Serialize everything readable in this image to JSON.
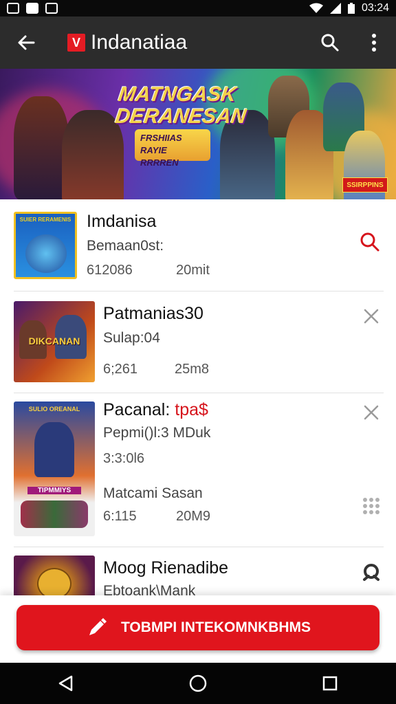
{
  "status_bar": {
    "time": "03:24"
  },
  "app_bar": {
    "title": "Indanatiaa",
    "logo_letter": "V"
  },
  "banner": {
    "title_line1": "MATNGASK",
    "title_line2": "DERANESAN",
    "sub_line1": "FRSHIIAS",
    "sub_line2": "RAYIE RRRREN",
    "badge": "SSIRPPINS"
  },
  "rows": [
    {
      "thumb_label": "SUIER RERAMENIS",
      "title": "Imdanisa",
      "subtitle": "Bemaan0st:",
      "meta_left": "612086",
      "meta_right": "20mit",
      "action_icon": "search-icon"
    },
    {
      "thumb_label": "DIKCANAN",
      "title": "Patmanias30",
      "subtitle": "Sulap:04",
      "meta_left": "6;261",
      "meta_right": "25m8",
      "action_icon": "close-icon"
    },
    {
      "thumb_label_top": "SULIO OREANAL",
      "thumb_label_bottom": "TIPMMIYS",
      "title": "Pacanal:",
      "title_highlight": "tpa$",
      "subtitle": "Pepmi()l:3 MDuk",
      "meta_extra": "3:3:0l6",
      "subtitle2": "Matcami Sasan",
      "meta_left": "6:115",
      "meta_right": "20M9",
      "action_icon": "close-icon",
      "action_icon2": "grid-dots-icon"
    },
    {
      "title": "Moog Rienadibe",
      "subtitle": "Ebtoank\\Mank",
      "action_icon": "user-badge-icon"
    }
  ],
  "cta": {
    "label": "TOBMPI INTEKOMNKBHMS"
  },
  "colors": {
    "accent": "#e0151d",
    "app_bar": "#2c2c2c",
    "status_bar": "#0a0a0a"
  }
}
